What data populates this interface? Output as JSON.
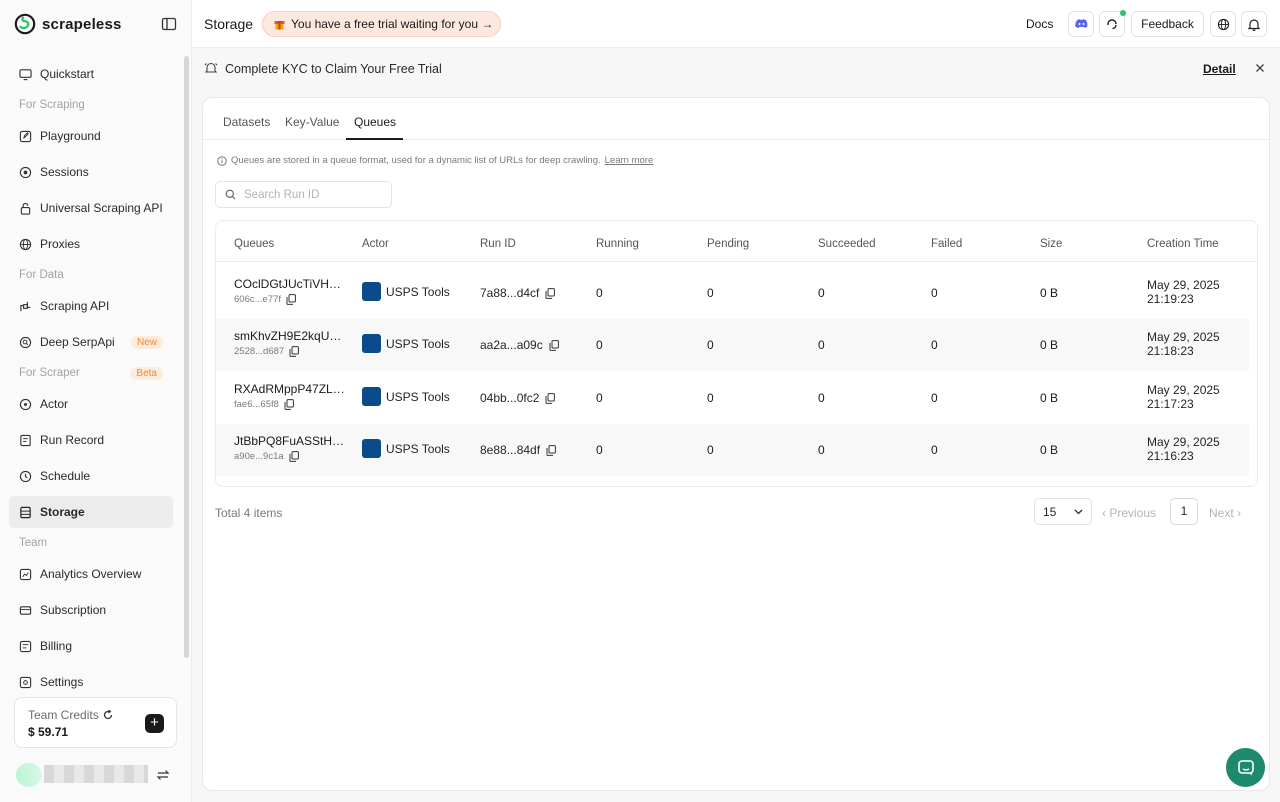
{
  "brand": {
    "name": "scrapeless"
  },
  "sidebar": {
    "items": [
      {
        "type": "item",
        "label": "Quickstart",
        "icon": "monitor-icon"
      },
      {
        "type": "section",
        "label": "For Scraping"
      },
      {
        "type": "item",
        "label": "Playground",
        "icon": "edit-square-icon"
      },
      {
        "type": "item",
        "label": "Sessions",
        "icon": "target-icon"
      },
      {
        "type": "item",
        "label": "Universal Scraping API",
        "icon": "lock-icon"
      },
      {
        "type": "item",
        "label": "Proxies",
        "icon": "globe-icon"
      },
      {
        "type": "section",
        "label": "For Data"
      },
      {
        "type": "item",
        "label": "Scraping API",
        "icon": "api-icon"
      },
      {
        "type": "item",
        "label": "Deep SerpApi",
        "icon": "search-circle-icon",
        "badge": "New"
      },
      {
        "type": "section",
        "label": "For Scraper",
        "badge": "Beta"
      },
      {
        "type": "item",
        "label": "Actor",
        "icon": "actor-icon"
      },
      {
        "type": "item",
        "label": "Run Record",
        "icon": "record-icon"
      },
      {
        "type": "item",
        "label": "Schedule",
        "icon": "clock-icon"
      },
      {
        "type": "item",
        "label": "Storage",
        "icon": "storage-icon",
        "active": true
      },
      {
        "type": "section",
        "label": "Team"
      },
      {
        "type": "item",
        "label": "Analytics Overview",
        "icon": "chart-icon"
      },
      {
        "type": "item",
        "label": "Subscription",
        "icon": "subscription-icon"
      },
      {
        "type": "item",
        "label": "Billing",
        "icon": "billing-icon"
      },
      {
        "type": "item",
        "label": "Settings",
        "icon": "gear-icon"
      }
    ],
    "credits": {
      "label": "Team Credits",
      "value": "$ 59.71"
    }
  },
  "header": {
    "title": "Storage",
    "trial_banner": "You have a free trial waiting for you →",
    "docs": "Docs",
    "feedback": "Feedback"
  },
  "kyc": {
    "text": "Complete KYC to Claim Your Free Trial",
    "detail": "Detail"
  },
  "tabs": [
    {
      "label": "Datasets"
    },
    {
      "label": "Key-Value"
    },
    {
      "label": "Queues",
      "active": true
    }
  ],
  "info": {
    "text": "Queues are stored in a queue format, used for a dynamic list of URLs for deep crawling.",
    "link": "Learn more"
  },
  "search": {
    "placeholder": "Search Run ID"
  },
  "table": {
    "columns": [
      "Queues",
      "Actor",
      "Run ID",
      "Running",
      "Pending",
      "Succeeded",
      "Failed",
      "Size",
      "Creation Time"
    ],
    "rows": [
      {
        "name": "COclDGtJUcTiVH3o...",
        "sub": "606c...e77f",
        "actor": "USPS Tools",
        "run_id": "7a88...d4cf",
        "running": "0",
        "pending": "0",
        "succeeded": "0",
        "failed": "0",
        "size": "0 B",
        "date": "May 29, 2025",
        "time": "21:19:23"
      },
      {
        "name": "smKhvZH9E2kqUTf...",
        "sub": "2528...d687",
        "actor": "USPS Tools",
        "run_id": "aa2a...a09c",
        "running": "0",
        "pending": "0",
        "succeeded": "0",
        "failed": "0",
        "size": "0 B",
        "date": "May 29, 2025",
        "time": "21:18:23"
      },
      {
        "name": "RXAdRMppP47ZLUj...",
        "sub": "fae6...65f8",
        "actor": "USPS Tools",
        "run_id": "04bb...0fc2",
        "running": "0",
        "pending": "0",
        "succeeded": "0",
        "failed": "0",
        "size": "0 B",
        "date": "May 29, 2025",
        "time": "21:17:23"
      },
      {
        "name": "JtBbPQ8FuASStHA...",
        "sub": "a90e...9c1a",
        "actor": "USPS Tools",
        "run_id": "8e88...84df",
        "running": "0",
        "pending": "0",
        "succeeded": "0",
        "failed": "0",
        "size": "0 B",
        "date": "May 29, 2025",
        "time": "21:16:23"
      }
    ]
  },
  "pagination": {
    "total": "Total 4 items",
    "page_size": "15",
    "previous": "Previous",
    "page": "1",
    "next": "Next"
  },
  "colors": {
    "accent_green": "#1d8a6e",
    "badge_bg": "#fdecdc",
    "badge_text": "#e98a3a",
    "trial_bg": "#fde8e0"
  }
}
